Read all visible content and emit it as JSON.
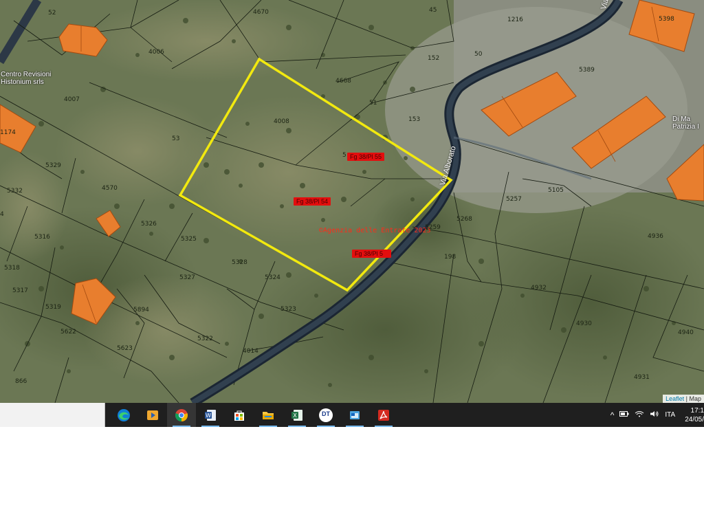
{
  "map": {
    "place_labels": {
      "centro_revisioni": "Centro Revisioni\nHistonium srls",
      "di_ma": "Di Ma\nPatrizia I"
    },
    "street_name": "Via Alborato",
    "street_top": "Via",
    "red_tags": {
      "pl55": "Fg 38/Pl 55",
      "pl54": "Fg 38/Pl 54",
      "pl_low": "Fg 38/Pl 5"
    },
    "watermark": "©Agenzia delle Entrate 2023",
    "parcels": {
      "p52": "52",
      "p4670": "4670",
      "p45": "45",
      "p1216": "1216",
      "p5398": "5398",
      "p4006": "4006",
      "p152": "152",
      "p50": "50",
      "p5389": "5389",
      "p4668": "4668",
      "p4007": "4007",
      "p51": "51",
      "p4008": "4008",
      "p153": "153",
      "p1174": "1174",
      "p53": "53",
      "p5": "5",
      "p5329": "5329",
      "p4570": "4570",
      "p5332": "5332",
      "p5257": "5257",
      "p5105": "5105",
      "p5326": "5326",
      "p5316": "5316",
      "p5325": "5325",
      "p5259": "5259",
      "p5268": "5268",
      "p4936": "4936",
      "p5318": "5318",
      "p5328": "5328",
      "p198": "198",
      "p5327": "5327",
      "p5324": "5324",
      "p5317": "5317",
      "p4932": "4932",
      "p5319": "5319",
      "p5894": "5894",
      "p5323": "5323",
      "p4930": "4930",
      "p5622": "5622",
      "p5322": "5322",
      "p4940": "4940",
      "p5623": "5623",
      "p4014": "4014",
      "p866": "866",
      "p4931": "4931",
      "p4": "4"
    },
    "attribution": {
      "leaflet": "Leaflet",
      "rest": "| Map"
    }
  },
  "taskbar": {
    "icons": [
      "edge-icon",
      "media-player-icon",
      "chrome-icon",
      "word-icon",
      "store-icon",
      "file-explorer-icon",
      "excel-icon",
      "dt-icon",
      "outlook-icon",
      "acrobat-icon"
    ],
    "dt_label": "DT",
    "tray": {
      "chevron": "^",
      "language": "ITA",
      "time": "17:1",
      "date": "24/05/"
    }
  }
}
